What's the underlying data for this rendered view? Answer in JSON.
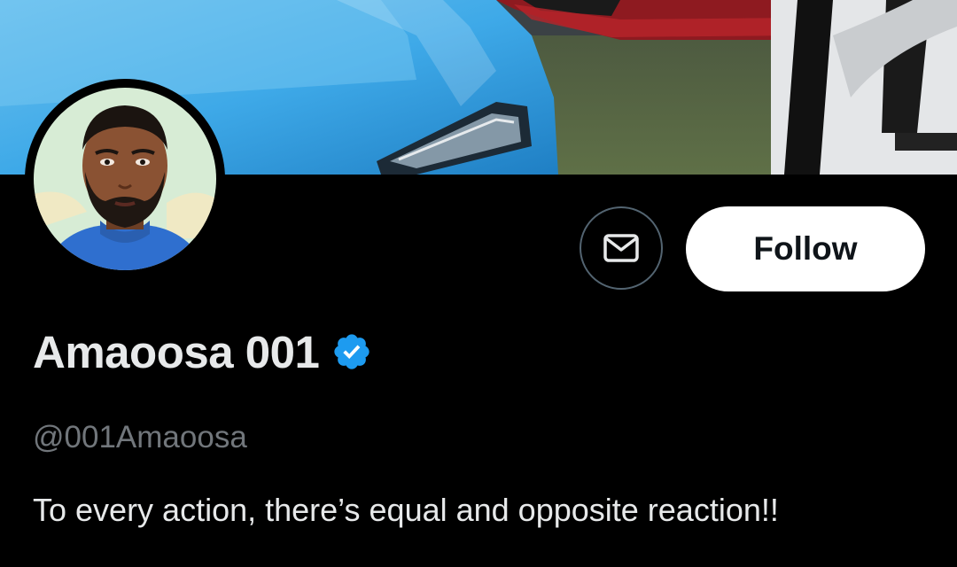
{
  "profile": {
    "display_name": "Amaoosa 001",
    "handle": "@001Amaoosa",
    "bio": "To every action, there’s equal and opposite reaction!!",
    "verified": true,
    "verified_color": "#1d9bf0"
  },
  "actions": {
    "message_icon": "envelope-icon",
    "follow_label": "Follow"
  },
  "banner": {
    "description_icon": "banner-image"
  },
  "colors": {
    "background": "#000000",
    "primary_text": "#e7e9ea",
    "secondary_text": "#71767b",
    "follow_bg": "#ffffff",
    "follow_text": "#0f1419",
    "border": "#536471"
  }
}
